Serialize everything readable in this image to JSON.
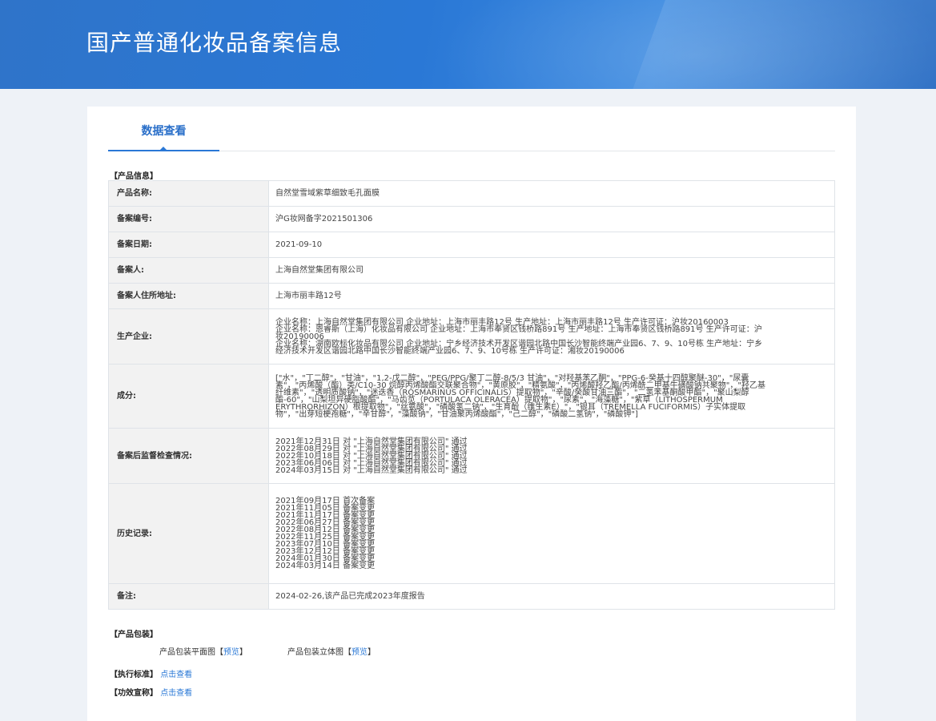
{
  "header": {
    "title": "国产普通化妆品备案信息"
  },
  "tabs": [
    {
      "label": "数据查看"
    }
  ],
  "product_info": {
    "section_title": "【产品信息】",
    "rows": {
      "name": {
        "label": "产品名称:",
        "value": "自然堂雪域紫草细致毛孔面膜"
      },
      "record_no": {
        "label": "备案编号:",
        "value": "沪G妆网备字2021501306"
      },
      "record_date": {
        "label": "备案日期:",
        "value": "2021-09-10"
      },
      "filer": {
        "label": "备案人:",
        "value": "上海自然堂集团有限公司"
      },
      "filer_address": {
        "label": "备案人住所地址:",
        "value": "上海市丽丰路12号"
      },
      "manufacturer": {
        "label": "生产企业:",
        "lines": [
          "企业名称：上海自然堂集团有限公司 企业地址：上海市丽丰路12号 生产地址：上海市丽丰路12号 生产许可证：沪妆20160003",
          "企业名称：恩睿斯（上海）化妆品有限公司 企业地址：上海市奉贤区钱桥路891号 生产地址：上海市奉贤区钱桥路891号 生产许可证：沪",
          "妆20190006",
          "企业名称：湖南欧标化妆品有限公司 企业地址：宁乡经济技术开发区谐园北路中国长沙智能终端产业园6、7、9、10号栋 生产地址：宁乡",
          "经济技术开发区谐园北路中国长沙智能终端产业园6、7、9、10号栋 生产许可证：湘妆20190006"
        ]
      },
      "ingredients": {
        "label": "成分:",
        "lines": [
          "[\"水\"，\"丁二醇\"，\"甘油\"，\"1,2-戊二醇\"，\"PEG/PPG/聚丁二醇-8/5/3 甘油\"，\"对羟基苯乙酮\"，\"PPG-6-癸基十四醇聚醚-30\"，\"尿囊",
          "素\"，\"丙烯酸（酯）类/C10-30 烷醇丙烯酸酯交联聚合物\"，\"黄原胶\"，\"精氨酸\"，\"丙烯酸羟乙酯/丙烯酰二甲基牛磺酸钠共聚物\"，\"羟乙基",
          "纤维素\"，\"透明质酸钠\"，\"迷迭香（ROSMARINUS OFFICINALIS）提取物\"，\"辛酸/癸酸甘油三酯\"，\"二氢苯基酮酸甲酯\"，\"聚山梨醇",
          "酯-60\"，\"山梨坦异硬脂酸酯\"，\"马齿苋（PORTULACA OLERACEA）提取物\"，\"尿素\"，\"海藻糖\"，\"紫草（LITHOSPERMUM",
          "ERYTHRORHIZON）根提取物\"，\"丝氨酸\"，\"磷酸氢二钠\"，\"生育酚（维生素E）\"，\"银耳（TREMELLA FUCIFORMIS）子实体提取",
          "物\"，\"出芽短梗孢糖\"，\"辛甘醇\"，\"藻酸钠\"，\"甘油聚丙烯酸酯\"，\"己二醇\"，\"磷酸二氢钠\"，\"磷酸钾\"]"
        ]
      },
      "inspections": {
        "label": "备案后监督检查情况:",
        "lines": [
          "2021年12月31日 对 \"上海自然堂集团有限公司\" 通过",
          "2022年08月29日 对 \"上海自然堂集团有限公司\" 通过",
          "2022年10月18日 对 \"上海自然堂集团有限公司\" 通过",
          "2023年06月06日 对 \"上海自然堂集团有限公司\" 通过",
          "2024年03月15日 对 \"上海自然堂集团有限公司\" 通过"
        ]
      },
      "history": {
        "label": "历史记录:",
        "lines": [
          "2021年09月17日 首次备案",
          "2021年11月05日 备案变更",
          "2021年11月17日 备案变更",
          "2022年06月27日 备案变更",
          "2022年08月12日 备案变更",
          "2022年11月25日 备案变更",
          "2023年07月10日 备案变更",
          "2023年12月12日 备案变更",
          "2024年01月30日 备案变更",
          "2024年03月14日 备案变更"
        ]
      },
      "remark": {
        "label": "备注:",
        "value": "2024-02-26,该产品已完成2023年度报告"
      }
    }
  },
  "packaging": {
    "section_title": "【产品包装】",
    "flat": {
      "label": "产品包装平面图",
      "bracket_open": "【",
      "link": "预览",
      "bracket_close": "】"
    },
    "solid": {
      "label": "产品包装立体图",
      "bracket_open": "【",
      "link": "预览",
      "bracket_close": "】"
    }
  },
  "standard": {
    "label": "【执行标准】",
    "link": "点击查看"
  },
  "efficacy": {
    "label": "【功效宣称】",
    "link": "点击查看"
  }
}
